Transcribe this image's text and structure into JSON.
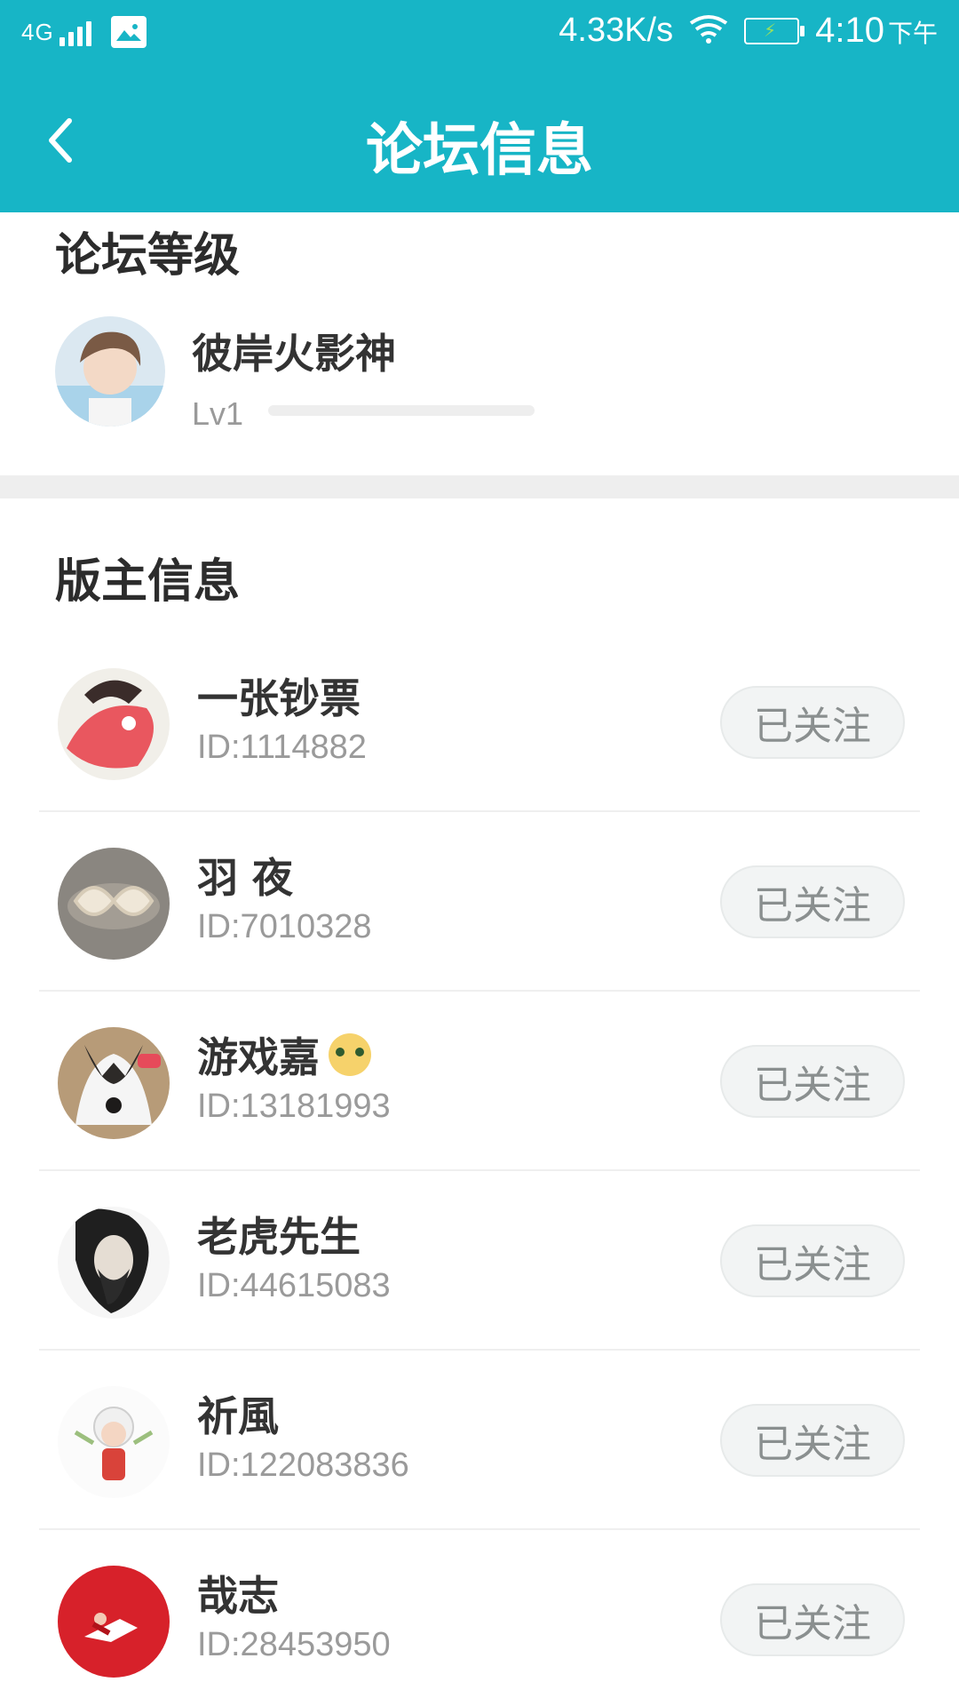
{
  "status_bar": {
    "network": "4G",
    "speed": "4.33K/s",
    "time": "4:10",
    "ampm": "下午",
    "icons": [
      "signal-icon",
      "image-icon",
      "wifi-icon",
      "battery-charging-icon"
    ]
  },
  "header": {
    "title": "论坛信息",
    "back_icon": "chevron-left-icon"
  },
  "forum_level": {
    "section_title": "论坛等级",
    "user_name": "彼岸火影神",
    "level": "Lv1",
    "progress_fraction": 0.0
  },
  "moderators": {
    "section_title": "版主信息",
    "items": [
      {
        "name": "一张钞票",
        "id": "ID:1114882",
        "button": "已关注"
      },
      {
        "name": "羽 夜",
        "id": "ID:7010328",
        "button": "已关注"
      },
      {
        "name": "游戏嘉",
        "id": "ID:13181993",
        "button": "已关注",
        "badge": "emoji-badge-icon"
      },
      {
        "name": "老虎先生",
        "id": "ID:44615083",
        "button": "已关注"
      },
      {
        "name": "祈風",
        "id": "ID:122083836",
        "button": "已关注"
      },
      {
        "name": "哉志",
        "id": "ID:28453950",
        "button": "已关注"
      }
    ]
  },
  "colors": {
    "accent": "#17b5c6",
    "divider": "#eeeeee"
  }
}
